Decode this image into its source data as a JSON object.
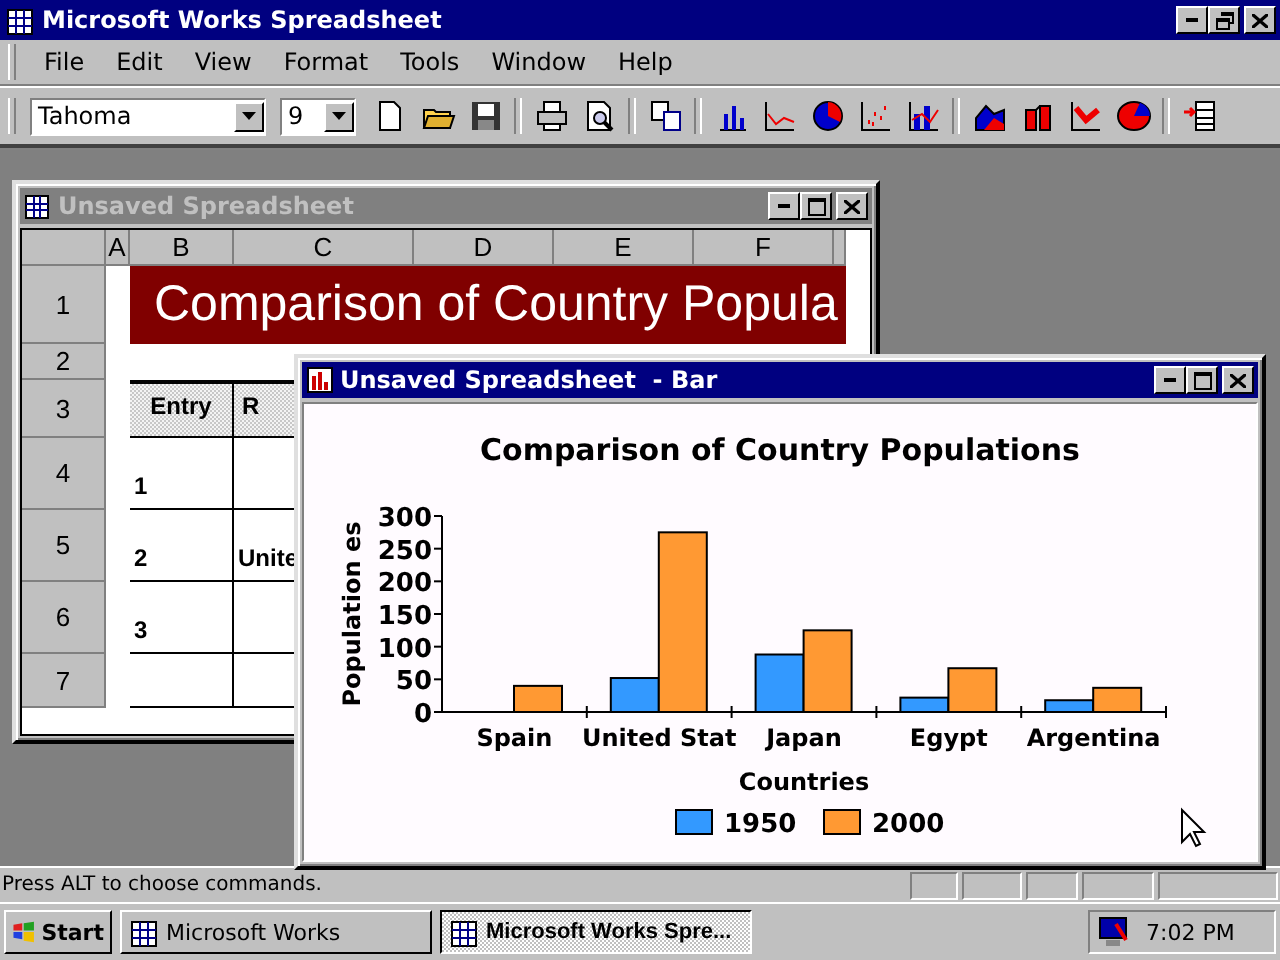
{
  "window": {
    "title": "Microsoft Works Spreadsheet"
  },
  "menu": [
    {
      "label": "File"
    },
    {
      "label": "Edit"
    },
    {
      "label": "View"
    },
    {
      "label": "Format"
    },
    {
      "label": "Tools"
    },
    {
      "label": "Window"
    },
    {
      "label": "Help"
    }
  ],
  "toolbar": {
    "font": "Tahoma",
    "size": "9"
  },
  "spreadsheet": {
    "title": "Unsaved Spreadsheet",
    "active": false,
    "columns": [
      "A",
      "B",
      "C",
      "D",
      "E",
      "F"
    ],
    "rows": [
      {
        "label": "1",
        "title": "Comparison of Country Popula"
      },
      {
        "label": "2"
      },
      {
        "label": "3",
        "cells": {
          "B": "Entry",
          "C": "R"
        }
      },
      {
        "label": "4",
        "cells": {
          "B": "1"
        }
      },
      {
        "label": "5",
        "cells": {
          "B": "2",
          "C": "Unite"
        }
      },
      {
        "label": "6",
        "cells": {
          "B": "3"
        }
      },
      {
        "label": "7"
      }
    ]
  },
  "chart_window": {
    "title": "Unsaved Spreadsheet  - Bar",
    "active": true,
    "chart_data": {
      "type": "bar",
      "title": "Comparison of Country Populations",
      "xlabel": "Countries",
      "ylabel": "Population es",
      "categories": [
        "Spain",
        "United Stat",
        "Japan",
        "Egypt",
        "Argentina"
      ],
      "series": [
        {
          "name": "1950",
          "color": "#3399ff",
          "values": [
            null,
            52,
            88,
            22,
            18
          ]
        },
        {
          "name": "2000",
          "color": "#ff9933",
          "values": [
            40,
            275,
            125,
            67,
            37
          ]
        }
      ],
      "ylim": [
        0,
        300
      ],
      "yticks": [
        0,
        50,
        100,
        150,
        200,
        250,
        300
      ],
      "legend": true
    }
  },
  "status_bar": {
    "text": "Press ALT to choose commands."
  },
  "taskbar": {
    "start": "Start",
    "buttons": [
      {
        "label": "Microsoft Works",
        "selected": false
      },
      {
        "label": "Microsoft Works Spre...",
        "selected": true
      }
    ],
    "clock": "7:02 PM"
  }
}
